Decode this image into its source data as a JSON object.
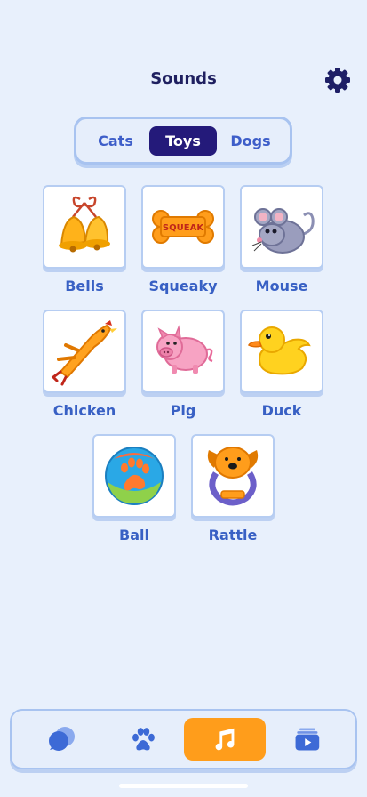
{
  "header": {
    "title": "Sounds"
  },
  "segments": [
    {
      "label": "Cats",
      "active": false
    },
    {
      "label": "Toys",
      "active": true
    },
    {
      "label": "Dogs",
      "active": false
    }
  ],
  "sounds": [
    {
      "label": "Bells"
    },
    {
      "label": "Squeaky",
      "tag": "SQUEAK"
    },
    {
      "label": "Mouse"
    },
    {
      "label": "Chicken"
    },
    {
      "label": "Pig"
    },
    {
      "label": "Duck"
    },
    {
      "label": "Ball"
    },
    {
      "label": "Rattle"
    }
  ],
  "tabbar": {
    "tabs": [
      {
        "icon": "chat-bubbles-icon",
        "active": false
      },
      {
        "icon": "paw-icon",
        "active": false
      },
      {
        "icon": "music-note-icon",
        "active": true
      },
      {
        "icon": "video-library-icon",
        "active": false
      }
    ]
  },
  "colors": {
    "background": "#e8f0fc",
    "accent": "#ff9d1b",
    "active_segment": "#241a7a",
    "label": "#3860c4"
  }
}
